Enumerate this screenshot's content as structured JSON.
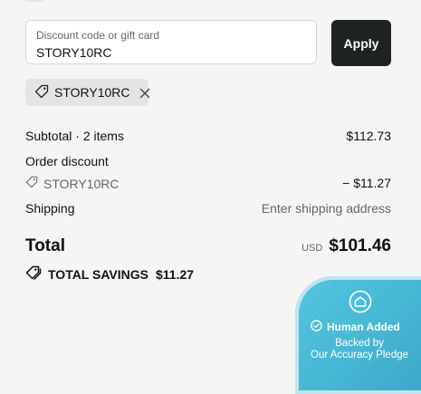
{
  "discount": {
    "placeholder": "Discount code or gift card",
    "value": "STORY10RC",
    "apply_label": "Apply"
  },
  "applied_code": {
    "label": "STORY10RC"
  },
  "summary": {
    "subtotal_label": "Subtotal · 2 items",
    "subtotal_value": "$112.73",
    "order_discount_label": "Order discount",
    "discount_code": "STORY10RC",
    "discount_value": "− $11.27",
    "shipping_label": "Shipping",
    "shipping_value": "Enter shipping address",
    "total_label": "Total",
    "currency": "USD",
    "total_value": "$101.46",
    "savings_label": "TOTAL SAVINGS",
    "savings_value": "$11.27"
  },
  "badge": {
    "title": "Human Added",
    "line1": "Backed by",
    "line2": "Our Accuracy Pledge"
  },
  "colors": {
    "apply_button": "#1f2223",
    "chip_bg": "#e4e4e4",
    "badge_accent": "#45b6d3"
  },
  "icons": [
    "tag-icon",
    "close-icon",
    "house-icon",
    "check-circle-icon"
  ]
}
